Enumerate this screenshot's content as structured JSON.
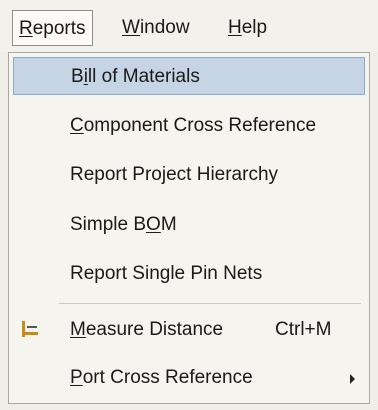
{
  "menubar": {
    "reports": {
      "before": "",
      "mnemonic": "R",
      "after": "eports"
    },
    "window": {
      "before": "",
      "mnemonic": "W",
      "after": "indow"
    },
    "help": {
      "before": "",
      "mnemonic": "H",
      "after": "elp"
    }
  },
  "menu": {
    "items": [
      {
        "before": "B",
        "mnemonic": "i",
        "after": "ll of Materials",
        "shortcut": ""
      },
      {
        "before": "",
        "mnemonic": "C",
        "after": "omponent Cross Reference",
        "shortcut": ""
      },
      {
        "before": "Report Project Hierarchy",
        "mnemonic": "",
        "after": "",
        "shortcut": ""
      },
      {
        "before": "Simple B",
        "mnemonic": "O",
        "after": "M",
        "shortcut": ""
      },
      {
        "before": "Report Single Pin Nets",
        "mnemonic": "",
        "after": "",
        "shortcut": ""
      },
      {
        "before": "",
        "mnemonic": "M",
        "after": "easure Distance",
        "shortcut": "Ctrl+M",
        "icon": "measure-ruler-icon"
      },
      {
        "before": "",
        "mnemonic": "P",
        "after": "ort Cross Reference",
        "shortcut": "",
        "submenu": "submenu-arrow-icon"
      }
    ]
  },
  "colors": {
    "highlight": "#c6d5e6",
    "menu_background": "#f6f4ef",
    "icon_accent": "#c98a16"
  }
}
